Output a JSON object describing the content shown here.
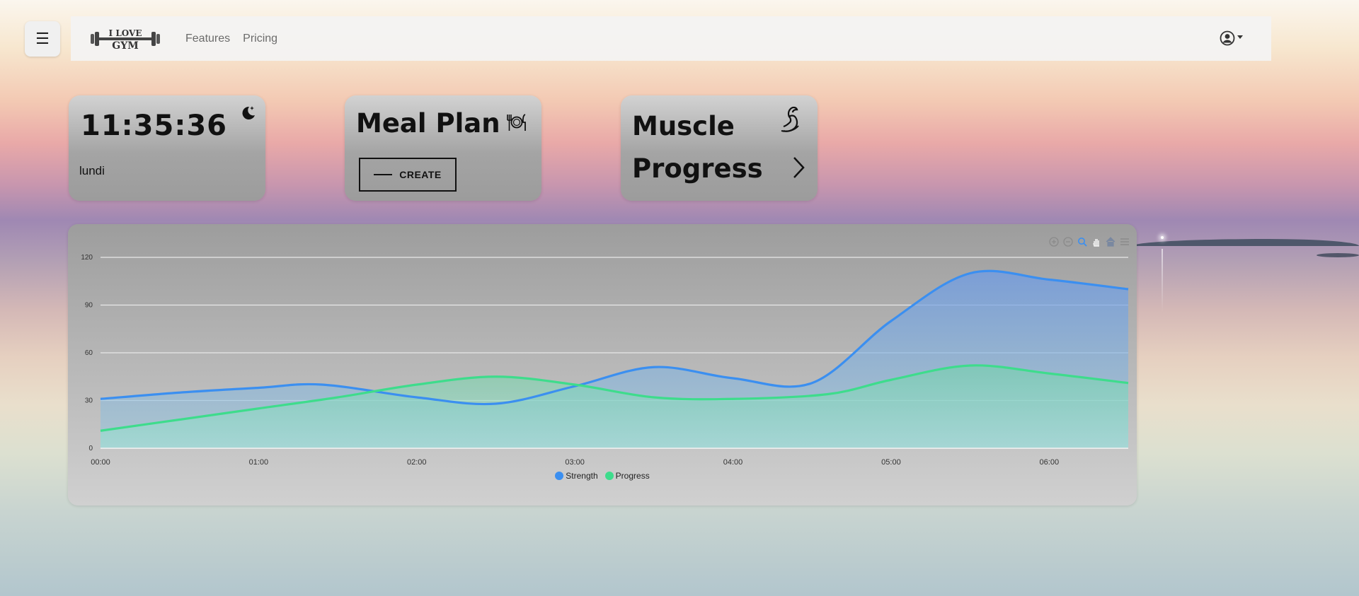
{
  "nav": {
    "menu_icon": "☰",
    "logo_line1": "I LOVE",
    "logo_line2": "GYM",
    "links": [
      "Features",
      "Pricing"
    ],
    "user_icon": "user-circle-icon"
  },
  "cards": {
    "clock": {
      "time": "11:35:36",
      "day": "lundi",
      "icon": "moon-stars-icon"
    },
    "meal": {
      "title": "Meal Plan",
      "button": "CREATE",
      "icon": "utensils-icon"
    },
    "muscle": {
      "title_line1": "Muscle",
      "title_line2": "Progress",
      "icon": "flexed-arm-icon"
    }
  },
  "colors": {
    "strength": "#3b8ff0",
    "progress": "#3edc8c"
  },
  "chart_data": {
    "type": "area",
    "x": [
      "00:00",
      "01:00",
      "02:00",
      "03:00",
      "04:00",
      "05:00",
      "06:00"
    ],
    "yticks": [
      0,
      30,
      60,
      90,
      120
    ],
    "ylim": [
      0,
      120
    ],
    "series": [
      {
        "name": "Strength",
        "points": [
          [
            0,
            31
          ],
          [
            0.5,
            35
          ],
          [
            1,
            38
          ],
          [
            1.4,
            40
          ],
          [
            2,
            32
          ],
          [
            2.5,
            28
          ],
          [
            3,
            39
          ],
          [
            3.5,
            51
          ],
          [
            4,
            44
          ],
          [
            4.5,
            41
          ],
          [
            5,
            80
          ],
          [
            5.5,
            110
          ],
          [
            6,
            106
          ],
          [
            6.5,
            100
          ]
        ]
      },
      {
        "name": "Progress",
        "points": [
          [
            0,
            11
          ],
          [
            0.5,
            18
          ],
          [
            1,
            25
          ],
          [
            1.5,
            32
          ],
          [
            2,
            40
          ],
          [
            2.5,
            45
          ],
          [
            3,
            40
          ],
          [
            3.5,
            32
          ],
          [
            4,
            31
          ],
          [
            4.6,
            34
          ],
          [
            5,
            43
          ],
          [
            5.5,
            52
          ],
          [
            6,
            47
          ],
          [
            6.5,
            41
          ]
        ]
      }
    ],
    "legend": "bottom-center"
  }
}
